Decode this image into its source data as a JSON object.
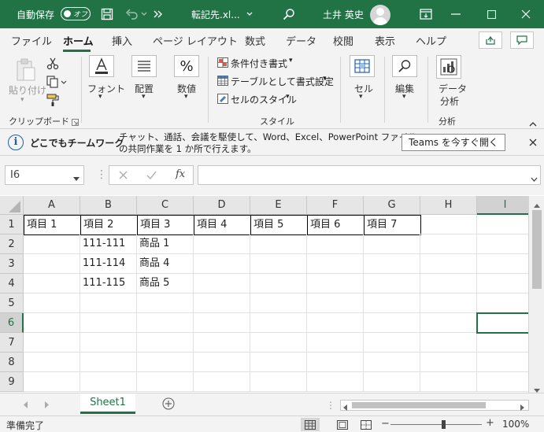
{
  "titlebar": {
    "autosave_label": "自動保存",
    "autosave_state": "オフ",
    "filename": "転記先.xl...",
    "user_name": "土井 英史"
  },
  "tabs": [
    {
      "label": "ファイル"
    },
    {
      "label": "ホーム"
    },
    {
      "label": "挿入"
    },
    {
      "label": "ページ レイアウト"
    },
    {
      "label": "数式"
    },
    {
      "label": "データ"
    },
    {
      "label": "校閲"
    },
    {
      "label": "表示"
    },
    {
      "label": "ヘルプ"
    }
  ],
  "ribbon": {
    "paste": "貼り付け",
    "clipboard_group": "クリップボード",
    "font": "フォント",
    "alignment": "配置",
    "number": "数値",
    "conditional_format": "条件付き書式",
    "format_as_table": "テーブルとして書式設定",
    "cell_styles": "セルのスタイル",
    "style_group": "スタイル",
    "cells": "セル",
    "editing": "編集",
    "data_analysis_1": "データ",
    "data_analysis_2": "分析",
    "analysis_group": "分析"
  },
  "infobar": {
    "title": "どこでもチームワーク",
    "message_line1": "チャット、通話、会議を駆使して、Word、Excel、PowerPoint ファイル",
    "message_line2": "の共同作業を 1 か所で行えます。",
    "button": "Teams を今すぐ開く"
  },
  "formula_bar": {
    "name_box": "I6",
    "fx": "fx"
  },
  "grid": {
    "columns": [
      "A",
      "B",
      "C",
      "D",
      "E",
      "F",
      "G",
      "H",
      "I"
    ],
    "rows": [
      "1",
      "2",
      "3",
      "4",
      "5",
      "6",
      "7",
      "8",
      "9"
    ],
    "selected_column": "I",
    "selected_row": "6",
    "header_row": [
      "項目 1",
      "項目 2",
      "項目 3",
      "項目 4",
      "項目 5",
      "項目 6",
      "項目 7"
    ],
    "data": [
      {
        "b": "111-111",
        "c": "商品 1"
      },
      {
        "b": "111-114",
        "c": "商品 4"
      },
      {
        "b": "111-115",
        "c": "商品 5"
      }
    ]
  },
  "sheet_tab": "Sheet1",
  "status": {
    "ready": "準備完了",
    "zoom": "100%"
  },
  "colors": {
    "accent": "#217346"
  }
}
